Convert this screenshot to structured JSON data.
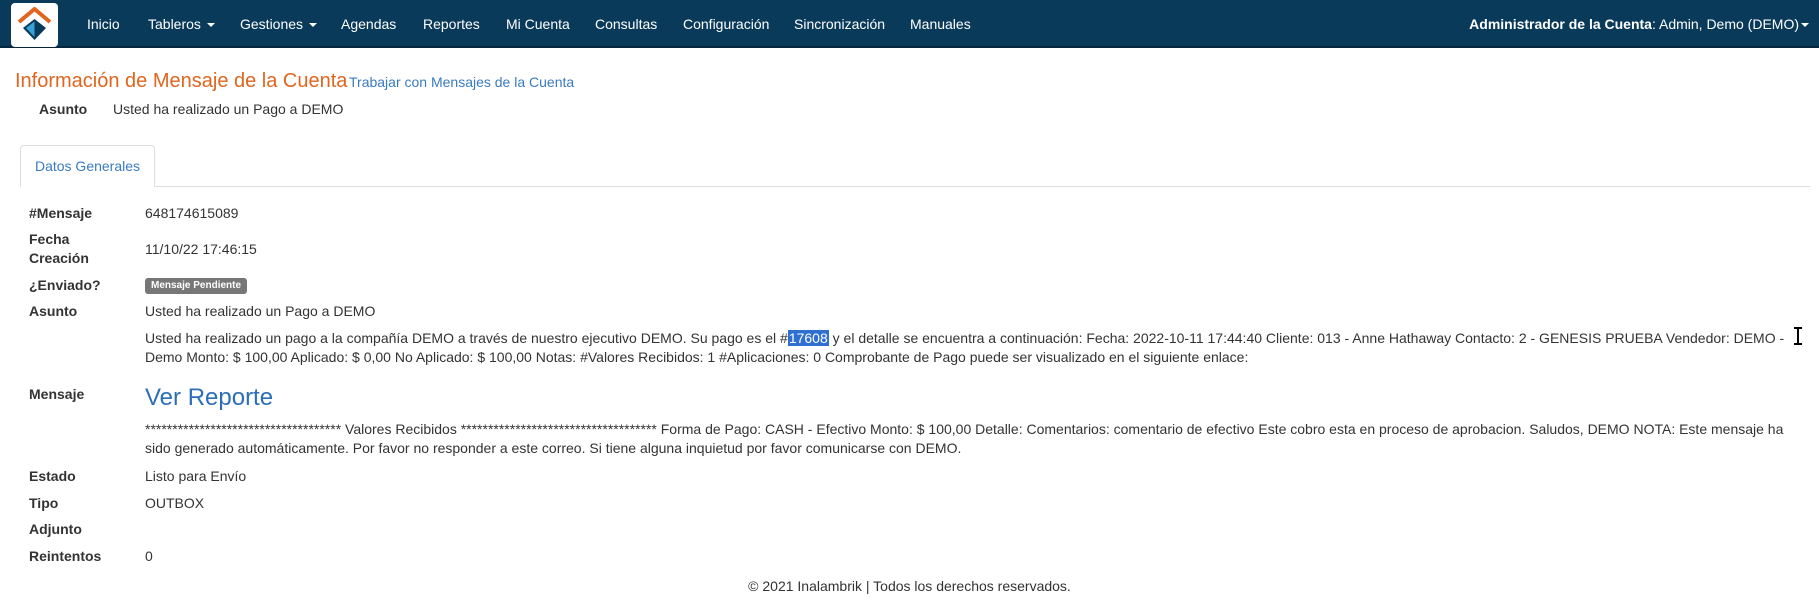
{
  "nav": {
    "items": [
      {
        "label": "Inicio",
        "dropdown": false
      },
      {
        "label": "Tableros",
        "dropdown": true
      },
      {
        "label": "Gestiones",
        "dropdown": true
      },
      {
        "label": "Agendas",
        "dropdown": false
      },
      {
        "label": "Reportes",
        "dropdown": false
      },
      {
        "label": "Mi Cuenta",
        "dropdown": false
      },
      {
        "label": "Consultas",
        "dropdown": false
      },
      {
        "label": "Configuración",
        "dropdown": false
      },
      {
        "label": "Sincronización",
        "dropdown": false
      },
      {
        "label": "Manuales",
        "dropdown": false
      }
    ],
    "account_role": "Administrador de la Cuenta",
    "account_user": ": Admin, Demo (DEMO)"
  },
  "header": {
    "title": "Información de Mensaje de la Cuenta",
    "link": "Trabajar con Mensajes de la Cuenta",
    "subject_label": "Asunto",
    "subject_value": "Usted ha realizado un Pago a DEMO"
  },
  "tabs": [
    {
      "label": "Datos Generales",
      "active": true
    }
  ],
  "fields": {
    "mensaje_id": {
      "label": "#Mensaje",
      "value": "648174615089"
    },
    "fecha": {
      "label_line1": "Fecha",
      "label_line2": "Creación",
      "value": "11/10/22 17:46:15"
    },
    "enviado": {
      "label": "¿Enviado?",
      "badge": "Mensaje Pendiente"
    },
    "asunto": {
      "label": "Asunto",
      "value": "Usted ha realizado un Pago a DEMO"
    },
    "mensaje": {
      "label": "Mensaje",
      "part1_before": "Usted ha realizado un pago a la compañía DEMO a través de nuestro ejecutivo DEMO. Su pago es el #",
      "part1_highlight": "17608",
      "part1_after": "y el detalle se encuentra a continuación: Fecha: 2022-10-11 17:44:40 Cliente: 013 - Anne Hathaway Contacto: 2 - GENESIS PRUEBA Vendedor: DEMO - Demo Monto: $ 100,00 Aplicado: $ 0,00 No Aplicado: $ 100,00 Notas: #Valores Recibidos: 1 #Aplicaciones: 0 Comprobante de Pago puede ser visualizado en el siguiente enlace:",
      "report_link": "Ver Reporte",
      "part2": "************************************ Valores Recibidos ************************************ Forma de Pago: CASH - Efectivo Monto: $ 100,00 Detalle: Comentarios: comentario de efectivo Este cobro esta en proceso de aprobacion. Saludos, DEMO NOTA: Este mensaje ha sido generado automáticamente. Por favor no responder a este correo. Si tiene alguna inquietud por favor comunicarse con DEMO."
    },
    "estado": {
      "label": "Estado",
      "value": "Listo para Envío"
    },
    "tipo": {
      "label": "Tipo",
      "value": "OUTBOX"
    },
    "adjunto": {
      "label": "Adjunto",
      "value": ""
    },
    "reintentos": {
      "label": "Reintentos",
      "value": "0"
    }
  },
  "footer": {
    "text": "© 2021 Inalambrik | Todos los derechos reservados."
  },
  "colors": {
    "navbar": "#0a3a5a",
    "title": "#e0661f",
    "link": "#3a7bbf",
    "highlight": "#2f6fd0",
    "badge": "#777777"
  }
}
